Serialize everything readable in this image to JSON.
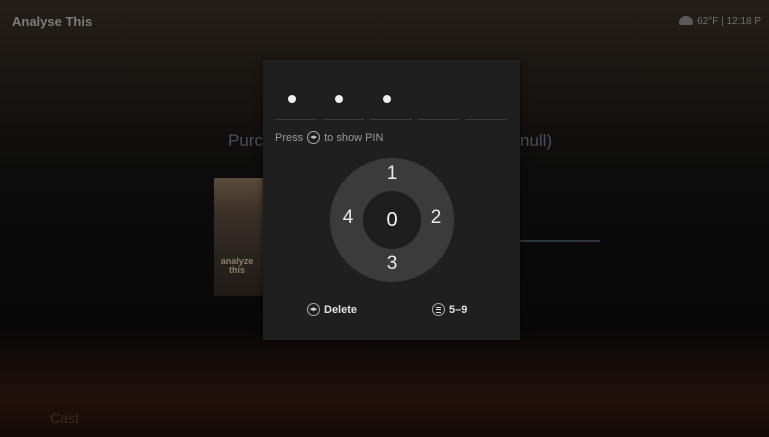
{
  "background": {
    "app_title": "Analyse This",
    "status_text": "62°F | 12:18 P",
    "purchase_text_left": "Purc",
    "purchase_text_right": "null)",
    "poster_text": "analyze this",
    "cast_heading": "Cast"
  },
  "pin_dialog": {
    "entered_count": 3,
    "slot_count": 5,
    "hint_prefix": "Press",
    "hint_suffix": "to show PIN",
    "dial": {
      "center": "0",
      "top": "1",
      "right": "2",
      "bottom": "3",
      "left": "4"
    },
    "delete_label": "Delete",
    "more_digits_label": "5–9"
  },
  "colors": {
    "dialog_bg": "#1f1f1f",
    "dial_ring": "#3b3b3b",
    "dial_center": "#1e1e1e"
  }
}
